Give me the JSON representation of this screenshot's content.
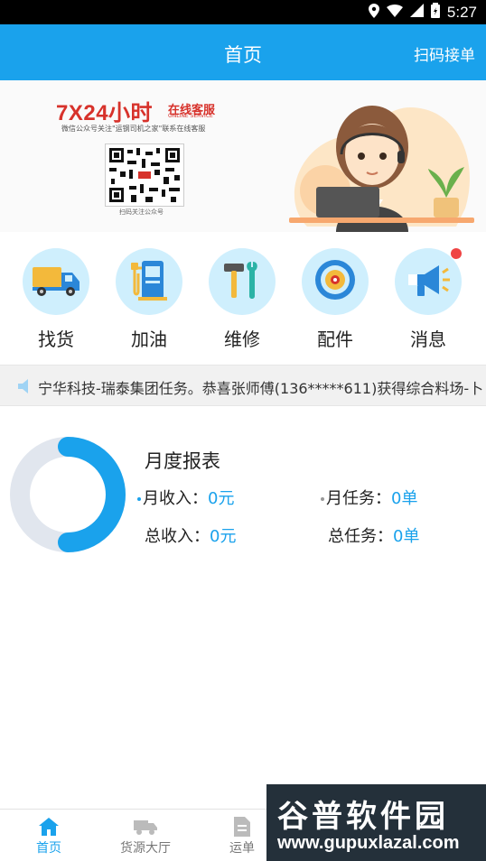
{
  "status_bar": {
    "time": "5:27"
  },
  "header": {
    "title": "首页",
    "scan_label": "扫码接单"
  },
  "banner": {
    "headline": "7X24小时",
    "service": "在线客服",
    "service_en": "ONLINE SERVICE",
    "subtitle": "微信公众号关注\"运钢司机之家\"联系在线客服",
    "qr_note": "扫码关注公众号"
  },
  "quick_actions": [
    {
      "label": "找货",
      "icon": "truck-icon"
    },
    {
      "label": "加油",
      "icon": "fuel-pump-icon"
    },
    {
      "label": "维修",
      "icon": "wrench-hammer-icon"
    },
    {
      "label": "配件",
      "icon": "gear-icon"
    },
    {
      "label": "消息",
      "icon": "megaphone-icon",
      "has_badge": true
    }
  ],
  "notice": {
    "text": "宁华科技-瑞泰集团任务。恭喜张师傅(136*****611)获得综合料场-卜"
  },
  "report": {
    "title": "月度报表",
    "monthly_income_label": "月收入：",
    "monthly_income_value": "0元",
    "monthly_tasks_label": "月任务：",
    "monthly_tasks_value": "0单",
    "total_income_label": "总收入：",
    "total_income_value": "0元",
    "total_tasks_label": "总任务：",
    "total_tasks_value": "0单"
  },
  "tabs": [
    {
      "label": "首页",
      "active": true
    },
    {
      "label": "货源大厅",
      "active": false
    },
    {
      "label": "运单",
      "active": false
    }
  ],
  "watermark": {
    "title": "谷普软件园",
    "url": "www.gupuxlazal.com"
  },
  "colors": {
    "primary": "#1aa2ec",
    "icon_bg": "#cfeffd",
    "badge": "#ef4444",
    "donut_track": "#e1e6ee"
  }
}
